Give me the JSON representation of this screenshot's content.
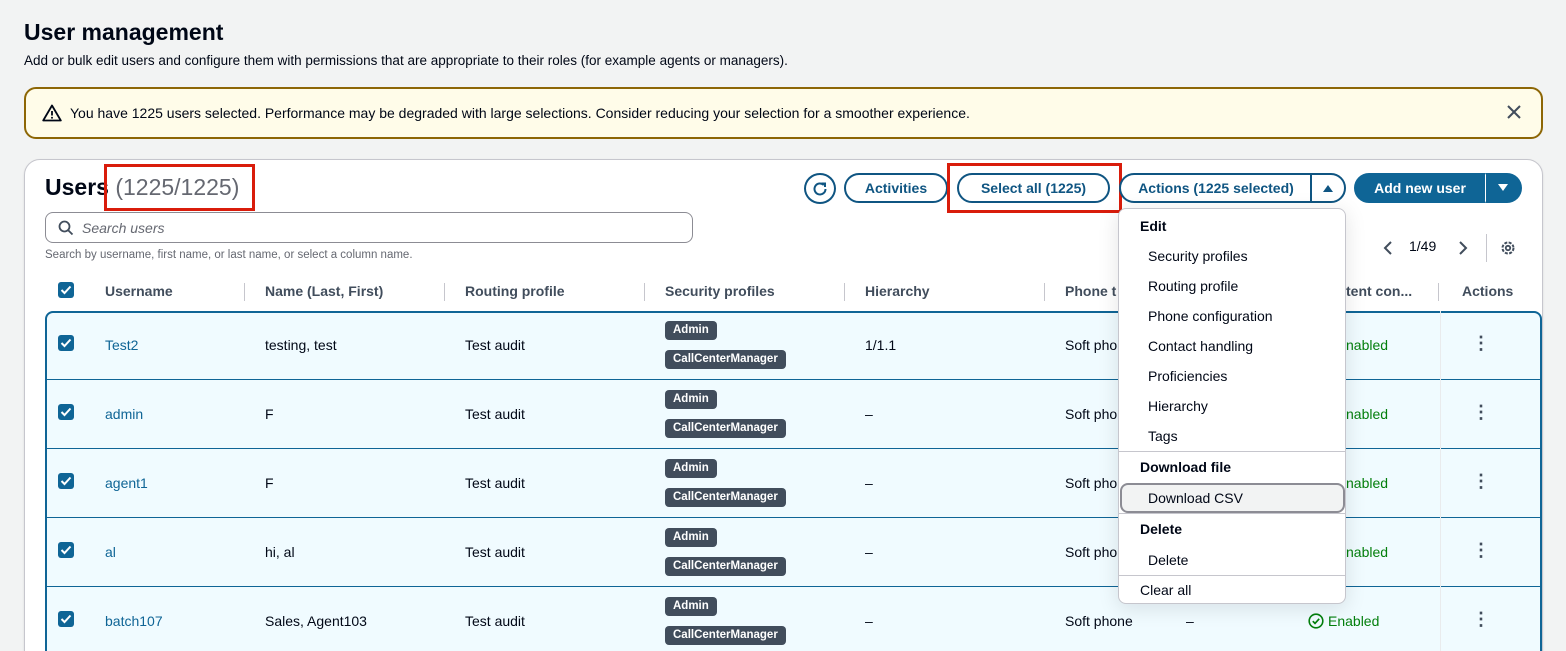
{
  "header": {
    "title": "User management",
    "description": "Add or bulk edit users and configure them with permissions that are appropriate to their roles (for example agents or managers)."
  },
  "alert": {
    "message": "You have 1225 users selected. Performance may be degraded with large selections. Consider reducing your selection for a smoother experience."
  },
  "users": {
    "title": "Users",
    "count": "(1225/1225)",
    "search_placeholder": "Search users",
    "search_hint": "Search by username, first name, or last name, or select a column name.",
    "page": "1/49"
  },
  "toolbar": {
    "activities": "Activities",
    "select_all": "Select all (1225)",
    "actions": "Actions (1225 selected)",
    "add_new_user": "Add new user"
  },
  "columns": {
    "username": "Username",
    "name": "Name (Last, First)",
    "routing": "Routing profile",
    "security": "Security profiles",
    "hierarchy": "Hierarchy",
    "phone": "Phone t",
    "content": "tent con...",
    "actions": "Actions"
  },
  "rows": [
    {
      "username": "Test2",
      "name": "testing, test",
      "routing": "Test audit",
      "badge1": "Admin",
      "badge2": "CallCenterManager",
      "hierarchy": "1/1.1",
      "phone": "Soft phone",
      "status": "nabled"
    },
    {
      "username": "admin",
      "name": "F",
      "routing": "Test audit",
      "badge1": "Admin",
      "badge2": "CallCenterManager",
      "hierarchy": "–",
      "phone": "Soft phon",
      "status": "nabled"
    },
    {
      "username": "agent1",
      "name": "F",
      "routing": "Test audit",
      "badge1": "Admin",
      "badge2": "CallCenterManager",
      "hierarchy": "–",
      "phone": "Soft phon",
      "status": "nabled"
    },
    {
      "username": "al",
      "name": "hi, al",
      "routing": "Test audit",
      "badge1": "Admin",
      "badge2": "CallCenterManager",
      "hierarchy": "–",
      "phone": "Soft pho",
      "status": "nabled"
    },
    {
      "username": "batch107",
      "name": "Sales, Agent103",
      "routing": "Test audit",
      "badge1": "Admin",
      "badge2": "CallCenterManager",
      "hierarchy": "–",
      "phone": "Soft phone",
      "extra": "–",
      "status": "Enabled"
    }
  ],
  "dropdown": {
    "edit_group": "Edit",
    "edit_items": [
      "Security profiles",
      "Routing profile",
      "Phone configuration",
      "Contact handling",
      "Proficiencies",
      "Hierarchy",
      "Tags"
    ],
    "download_group": "Download file",
    "download_item": "Download CSV",
    "delete_group": "Delete",
    "delete_item": "Delete",
    "clear_all": "Clear all"
  },
  "colors": {
    "accent": "#0f6596",
    "highlight": "#d91c0b",
    "warning_border": "#8d6605",
    "enabled": "#037f0c"
  }
}
